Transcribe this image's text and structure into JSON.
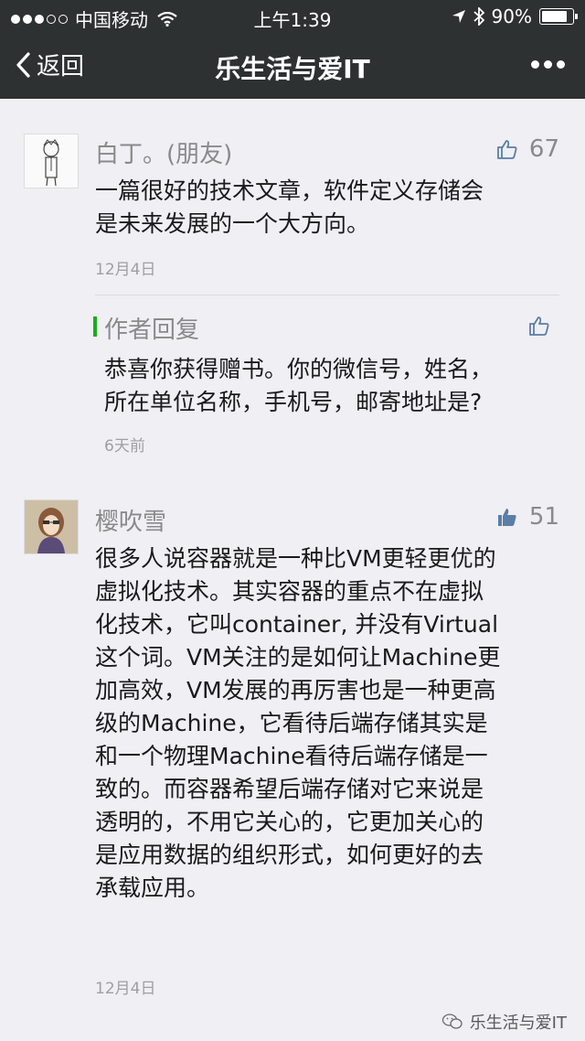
{
  "status": {
    "carrier": "中国移动",
    "time": "上午1:39",
    "battery": "90%",
    "battery_level": 0.9,
    "signal_dots": 5,
    "signal_filled": 3
  },
  "nav": {
    "back_label": "返回",
    "title": "乐生活与爱IT"
  },
  "comments": [
    {
      "name": "白丁。(朋友)",
      "likes": "67",
      "liked": false,
      "lines": [
        "一篇很好的技术文章，软件定义存储会",
        "是未来发展的一个大方向。"
      ],
      "date": "12月4日",
      "reply": {
        "title": "作者回复",
        "lines": [
          "恭喜你获得赠书。你的微信号，姓名，",
          "所在单位名称，手机号，邮寄地址是?"
        ],
        "date": "6天前"
      }
    },
    {
      "name": "樱吹雪",
      "likes": "51",
      "liked": true,
      "lines": [
        "很多人说容器就是一种比VM更轻更优的",
        "虚拟化技术。其实容器的重点不在虚拟",
        "化技术，它叫container, 并没有Virtual",
        "这个词。VM关注的是如何让Machine更",
        "加高效，VM发展的再厉害也是一种更高",
        "级的Machine，它看待后端存储其实是",
        "和一个物理Machine看待后端存储是一",
        "致的。而容器希望后端存储对它来说是",
        "透明的，不用它关心的，它更加关心的",
        "是应用数据的组织形式，如何更好的去",
        "承载应用。"
      ],
      "date": "12月4日"
    }
  ],
  "watermark": "乐生活与爱IT",
  "colors": {
    "topbar": "#2e3132",
    "accent_green": "#1aad19",
    "like_blue": "#5b7ea6",
    "background": "#efeff4"
  },
  "icons": [
    "back-chevron-icon",
    "wifi-icon",
    "location-arrow-icon",
    "bluetooth-icon",
    "battery-icon",
    "more-icon",
    "thumbs-up-icon",
    "wechat-icon"
  ]
}
